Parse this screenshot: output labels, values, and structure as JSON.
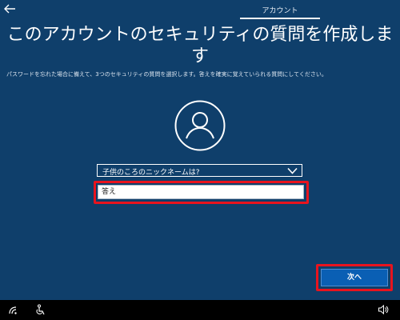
{
  "header": {
    "back_icon": "back-arrow-icon",
    "tab_label": "アカウント"
  },
  "main": {
    "title": "このアカウントのセキュリティの質問を作成します",
    "subtitle": "パスワードを忘れた場合に備えて、3つのセキュリティの質問を選択します。答えを確実に覚えていられる質問にしてください。",
    "avatar_icon": "user-avatar-icon",
    "question_select": {
      "selected": "子供のころのニックネームは?",
      "icon": "chevron-down-icon"
    },
    "answer_field": {
      "placeholder": "答え",
      "value": ""
    },
    "next_button": {
      "label": "次へ"
    }
  },
  "taskbar": {
    "icons": [
      "network-icon",
      "accessibility-icon",
      "volume-icon"
    ]
  },
  "colors": {
    "background": "#0f3f6b",
    "highlight": "#e8141e",
    "button": "#0a5fb4"
  }
}
